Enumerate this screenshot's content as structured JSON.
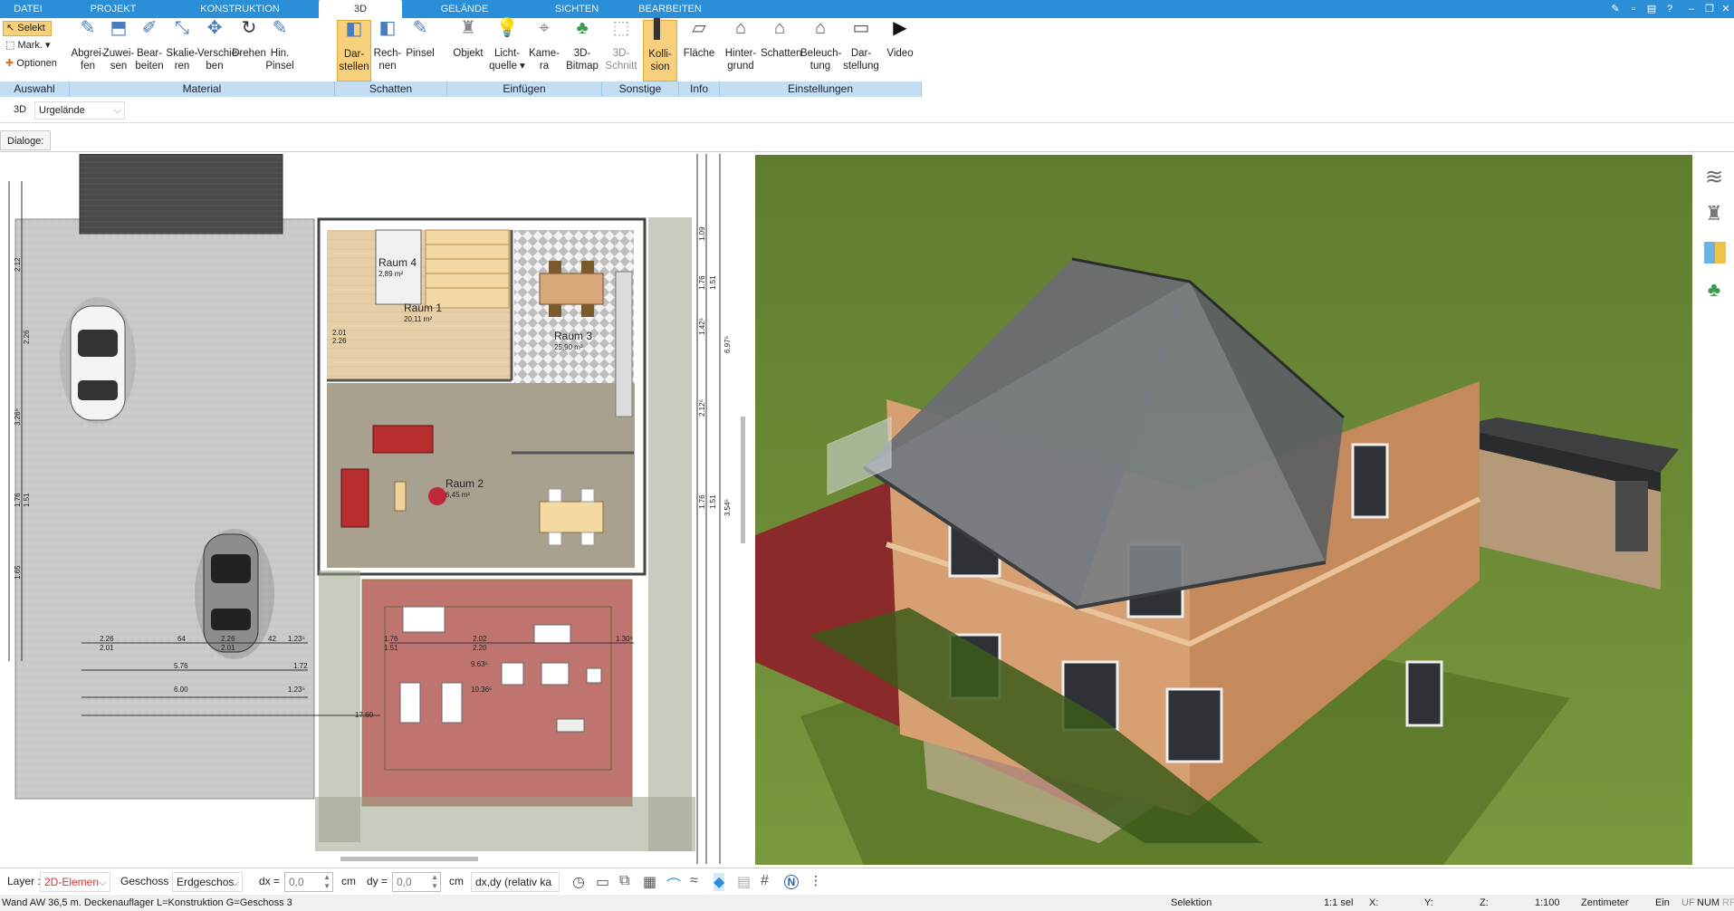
{
  "menu": {
    "tabs": [
      {
        "label": "DATEI"
      },
      {
        "label": "PROJEKT"
      },
      {
        "label": "KONSTRUKTION"
      },
      {
        "label": "3D"
      },
      {
        "label": "GELÄNDE"
      },
      {
        "label": "SICHTEN"
      },
      {
        "label": "BEARBEITEN"
      }
    ]
  },
  "ribbon": {
    "select": {
      "selekt": "Selekt",
      "mark": "Mark.",
      "optionen": "Optionen"
    },
    "buttons": [
      {
        "label1": "Abgrei-",
        "label2": "fen",
        "icon": "pipette-icon"
      },
      {
        "label1": "Zuwei-",
        "label2": "sen",
        "icon": "assign-material-icon"
      },
      {
        "label1": "Bear-",
        "label2": "beiten",
        "icon": "edit-material-icon"
      },
      {
        "label1": "Skalie-",
        "label2": "ren",
        "icon": "scale-icon"
      },
      {
        "label1": "Verschie-",
        "label2": "ben",
        "icon": "move-icon"
      },
      {
        "label1": "Drehen",
        "label2": "",
        "icon": "rotate-icon"
      },
      {
        "label1": "Hin.",
        "label2": "Pinsel",
        "icon": "background-brush-icon"
      },
      {
        "label1": "Dar-",
        "label2": "stellen",
        "icon": "shadow-display-icon"
      },
      {
        "label1": "Rech-",
        "label2": "nen",
        "icon": "shadow-compute-icon"
      },
      {
        "label1": "Pinsel",
        "label2": "",
        "icon": "shadow-brush-icon"
      },
      {
        "label1": "Objekt",
        "label2": "",
        "icon": "chair-icon"
      },
      {
        "label1": "Licht-",
        "label2": "quelle ▾",
        "icon": "lightbulb-icon"
      },
      {
        "label1": "Kame-",
        "label2": "ra",
        "icon": "camera-icon"
      },
      {
        "label1": "3D-",
        "label2": "Bitmap",
        "icon": "tree-icon"
      },
      {
        "label1": "3D-",
        "label2": "Schnitt",
        "icon": "section-icon"
      },
      {
        "label1": "Kolli-",
        "label2": "sion",
        "icon": "collision-icon"
      },
      {
        "label1": "Fläche",
        "label2": "",
        "icon": "area-icon"
      },
      {
        "label1": "Hinter-",
        "label2": "grund",
        "icon": "background-house-icon"
      },
      {
        "label1": "Schatten",
        "label2": "",
        "icon": "shadow-house-icon"
      },
      {
        "label1": "Beleuch-",
        "label2": "tung",
        "icon": "lighting-house-icon"
      },
      {
        "label1": "Dar-",
        "label2": "stellung",
        "icon": "display-monitor-icon"
      },
      {
        "label1": "Video",
        "label2": "",
        "icon": "play-icon"
      }
    ],
    "groups": [
      {
        "label": "Auswahl"
      },
      {
        "label": "Material"
      },
      {
        "label": "Schatten"
      },
      {
        "label": "Einfügen"
      },
      {
        "label": "Sonstige"
      },
      {
        "label": "Info"
      },
      {
        "label": "Einstellungen"
      }
    ]
  },
  "toolrow": {
    "mode": "3D",
    "terrain": "Urgelände"
  },
  "dialogrow": {
    "label": "Dialoge:"
  },
  "plan": {
    "rooms": [
      {
        "name": "Raum 4",
        "area": "2,89 m²"
      },
      {
        "name": "Raum 1",
        "area": "20,11 m²"
      },
      {
        "name": "Raum 3",
        "area": "25,90 m²"
      },
      {
        "name": "Raum 2",
        "area": "6,45 m²"
      }
    ],
    "dims": [
      "2.26",
      "2.01",
      "64",
      "2.26",
      "2.01",
      "42",
      "1.23⁵",
      "5.76",
      "1.72",
      "6.00",
      "1.23⁵",
      "1.76",
      "1.51",
      "2.02",
      "2.20",
      "1.30⁵",
      "9.63⁵",
      "10.36⁵",
      "17.60",
      "1.09",
      "1.76",
      "1.51",
      "1.42⁵",
      "6.97⁵",
      "2.12⁵",
      "1.76",
      "1.51",
      "3.54⁵",
      "2.12",
      "2.26",
      "3.26⁵",
      "1.76",
      "1.51",
      "1.65",
      "2.01",
      "2.26"
    ]
  },
  "status": {
    "layer_label": "Layer :",
    "layer_value": "2D-Elemen",
    "geschoss_label": "Geschoss :",
    "geschoss_value": "Erdgeschos",
    "dx_label": "dx =",
    "dx_value": "0,0",
    "dx_unit": "cm",
    "dy_label": "dy =",
    "dy_value": "0,0",
    "dy_unit": "cm",
    "mode_value": "dx,dy (relativ ka"
  },
  "info": {
    "left": "Wand AW 36,5 m. Deckenauflager L=Konstruktion G=Geschoss 3",
    "selection": "Selektion",
    "selcount": "1:1 sel",
    "x": "X:",
    "y": "Y:",
    "z": "Z:",
    "scale": "1:100",
    "unit": "Zentimeter",
    "ein": "Ein",
    "uf": "UF",
    "num": "NUM",
    "rf": "RF"
  },
  "colors": {
    "accent": "#2a8fd6",
    "group_bar": "#c3def3",
    "selected_btn": "#f8cf7a",
    "grass": "#6c8a3a",
    "terrace": "#b34a4a",
    "roof": "#6a6e72"
  }
}
